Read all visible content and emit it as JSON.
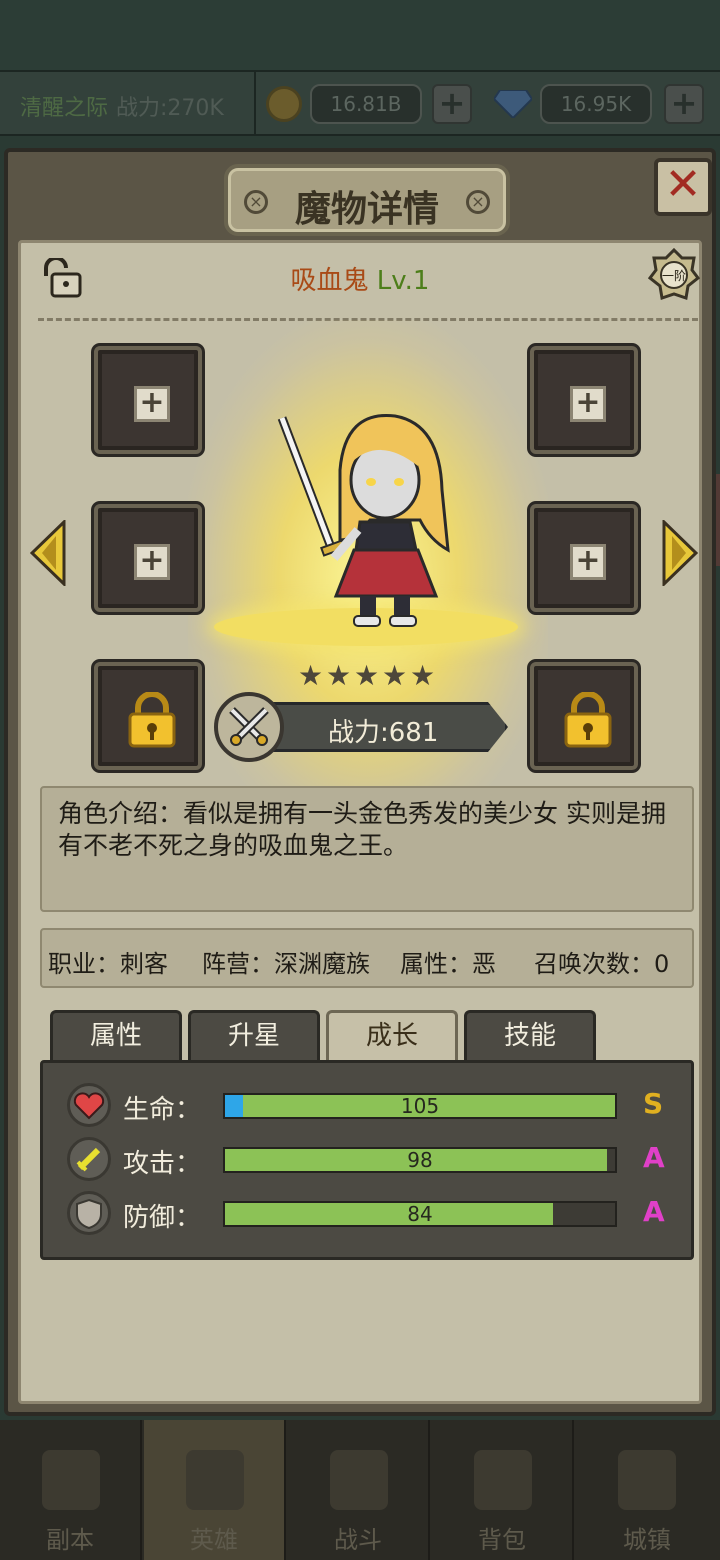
{
  "top_bar": {
    "server_name": "清醒之际",
    "power": "战力:270K",
    "gold": "16.81B",
    "gems": "16.95K",
    "plus": "+"
  },
  "dialog": {
    "title": "魔物详情",
    "close": "✕",
    "monster_name": "吸血鬼",
    "level": "Lv.1",
    "rank_badge": "一阶",
    "stars": [
      "★",
      "★",
      "★",
      "★",
      "★"
    ],
    "power": "战力:681",
    "intro": "角色介绍：看似是拥有一头金色秀发的美少女 实则是拥有不老不死之身的吸血鬼之王。",
    "info": {
      "job": "职业：刺客",
      "camp": "阵营：深渊魔族",
      "attribute": "属性：恶",
      "summon": "召唤次数：0"
    },
    "tabs": [
      "属性",
      "升星",
      "成长",
      "技能"
    ],
    "active_tab": "成长",
    "stats": [
      {
        "label": "生命：",
        "value": 105,
        "fill": 1.0,
        "grade": "S",
        "grade_color": "#e0b020",
        "icon": "heart-icon"
      },
      {
        "label": "攻击：",
        "value": 98,
        "fill": 0.98,
        "grade": "A",
        "grade_color": "#e040c8",
        "icon": "sword-icon"
      },
      {
        "label": "防御：",
        "value": 84,
        "fill": 0.84,
        "grade": "A",
        "grade_color": "#e040c8",
        "icon": "shield-icon"
      }
    ],
    "slot_plus": "+"
  },
  "bottom_nav": [
    "副本",
    "英雄",
    "战斗",
    "背包",
    "城镇"
  ]
}
